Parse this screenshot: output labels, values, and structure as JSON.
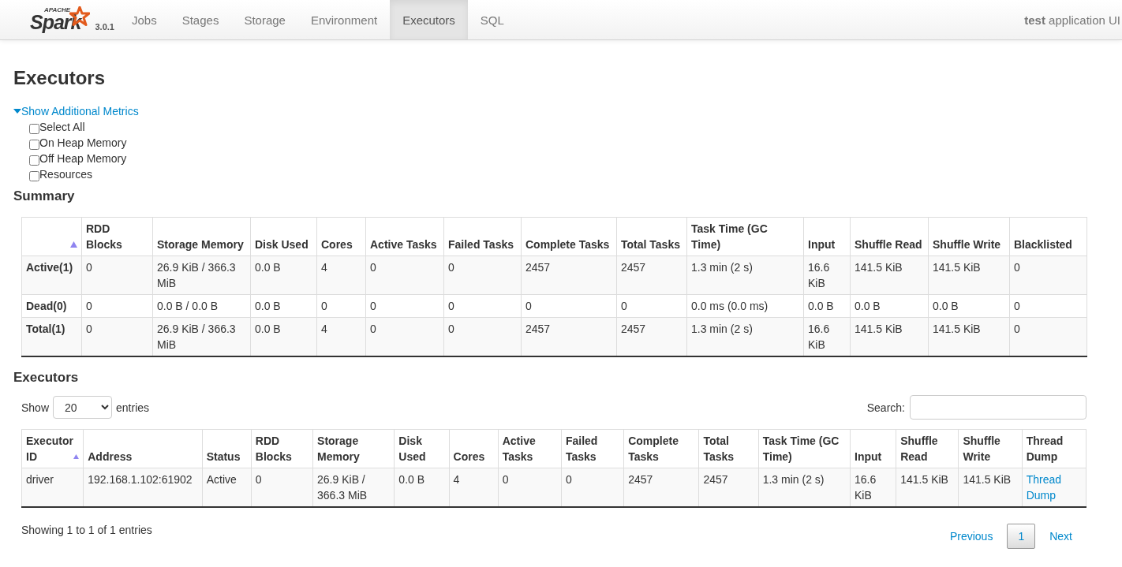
{
  "navbar": {
    "logo": {
      "apache": "APACHE",
      "brand": "Spark",
      "version": "3.0.1"
    },
    "tabs": [
      {
        "label": "Jobs",
        "selected": false
      },
      {
        "label": "Stages",
        "selected": false
      },
      {
        "label": "Storage",
        "selected": false
      },
      {
        "label": "Environment",
        "selected": false
      },
      {
        "label": "Executors",
        "selected": true
      },
      {
        "label": "SQL",
        "selected": false
      }
    ],
    "app_title": "**test** application UI"
  },
  "page_title": "Executors",
  "additional_metrics": {
    "label": "Show Additional Metrics",
    "expanded": true,
    "options": [
      {
        "label": "Select All",
        "checked": false
      },
      {
        "label": "On Heap Memory",
        "checked": false
      },
      {
        "label": "Off Heap Memory",
        "checked": false
      },
      {
        "label": "Resources",
        "checked": false
      }
    ]
  },
  "summary": {
    "title": "Summary",
    "columns": [
      {
        "sorted": true
      },
      {
        "label": "RDD Blocks",
        "sorted": false
      },
      {
        "label": "Storage Memory",
        "sorted": false
      },
      {
        "label": "Disk Used",
        "sorted": false
      },
      {
        "label": "Cores",
        "sorted": false
      },
      {
        "label": "Active Tasks",
        "sorted": false
      },
      {
        "label": "Failed Tasks",
        "sorted": false
      },
      {
        "label": "Complete Tasks",
        "sorted": false
      },
      {
        "label": "Total Tasks",
        "sorted": false
      },
      {
        "label": "Task Time (GC Time)",
        "sorted": false
      },
      {
        "label": "Input",
        "sorted": false
      },
      {
        "label": "Shuffle Read",
        "sorted": false
      },
      {
        "label": "Shuffle Write",
        "sorted": false
      },
      {
        "label": "Blacklisted",
        "sorted": false
      }
    ],
    "rows": [
      [
        "Active(1)",
        "0",
        "26.9 KiB / 366.3 MiB",
        "0.0 B",
        "4",
        "0",
        "0",
        "2457",
        "2457",
        "1.3 min (2 s)",
        "16.6 KiB",
        "141.5 KiB",
        "141.5 KiB",
        "0"
      ],
      [
        "Dead(0)",
        "0",
        "0.0 B / 0.0 B",
        "0.0 B",
        "0",
        "0",
        "0",
        "0",
        "0",
        "0.0 ms (0.0 ms)",
        "0.0 B",
        "0.0 B",
        "0.0 B",
        "0"
      ],
      [
        "Total(1)",
        "0",
        "26.9 KiB / 366.3 MiB",
        "0.0 B",
        "4",
        "0",
        "0",
        "2457",
        "2457",
        "1.3 min (2 s)",
        "16.6 KiB",
        "141.5 KiB",
        "141.5 KiB",
        "0"
      ]
    ]
  },
  "executors": {
    "title": "Executors",
    "length": {
      "before": "Show",
      "value": "20",
      "after": "entries"
    },
    "search": {
      "label": "Search:"
    },
    "columns": [
      {
        "label": "Executor ID",
        "sorted": true
      },
      {
        "label": "Address",
        "sorted": false
      },
      {
        "label": "Status",
        "sorted": false
      },
      {
        "label": "RDD Blocks",
        "sorted": false
      },
      {
        "label": "Storage Memory",
        "sorted": false
      },
      {
        "label": "Disk Used",
        "sorted": false
      },
      {
        "label": "Cores",
        "sorted": false
      },
      {
        "label": "Active Tasks",
        "sorted": false
      },
      {
        "label": "Failed Tasks",
        "sorted": false
      },
      {
        "label": "Complete Tasks",
        "sorted": false
      },
      {
        "label": "Total Tasks",
        "sorted": false
      },
      {
        "label": "Task Time (GC Time)",
        "sorted": false
      },
      {
        "label": "Input",
        "sorted": false
      },
      {
        "label": "Shuffle Read",
        "sorted": false
      },
      {
        "label": "Shuffle Write",
        "sorted": false
      },
      {
        "label": "Thread Dump",
        "sorted": false
      }
    ],
    "rows": [
      {
        "cells": [
          "driver",
          "192.168.1.102:61902",
          "Active",
          "0",
          "26.9 KiB / 366.3 MiB",
          "0.0 B",
          "4",
          "0",
          "0",
          "2457",
          "2457",
          "1.3 min (2 s)",
          "16.6 KiB",
          "141.5 KiB",
          "141.5 KiB"
        ],
        "link": "Thread Dump"
      }
    ],
    "info": "Showing 1 to 1 of 1 entries",
    "pagination": [
      {
        "label": "Previous",
        "selected": false
      },
      {
        "label": "1",
        "selected": true
      },
      {
        "label": "Next",
        "selected": false
      }
    ]
  }
}
